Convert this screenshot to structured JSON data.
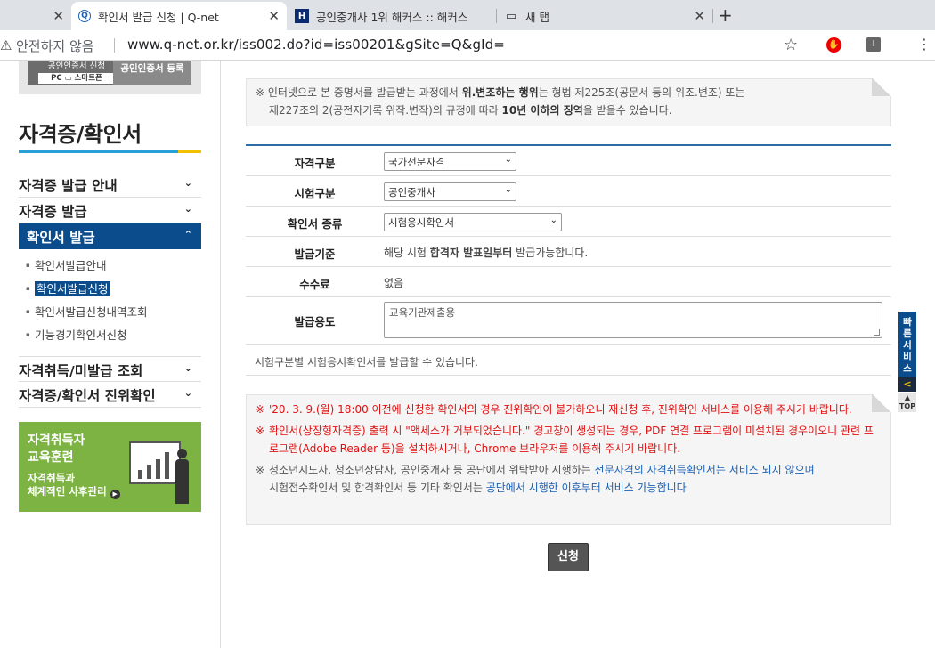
{
  "browser": {
    "tabs": [
      {
        "title": "",
        "close": "✕"
      },
      {
        "title": "확인서 발급 신청 | Q-net",
        "close": "✕",
        "fav": "Q"
      },
      {
        "title": "공인중개사 1위 해커스 :: 해커스",
        "close": "✕",
        "fav": "H"
      },
      {
        "title": "새 탭",
        "close": "✕",
        "fav": "▭"
      }
    ],
    "new_tab": "+",
    "security_text": "안전하지 않음",
    "url": "www.q-net.or.kr/iss002.do?id=iss00201&gSite=Q&gId="
  },
  "sidebar": {
    "cert_apply": "공인인증서 신청",
    "cert_pc": "PC ▭ 스마트폰",
    "cert_register": "공인인증서 등록",
    "title": "자격증/확인서",
    "menu": [
      {
        "label": "자격증 발급 안내"
      },
      {
        "label": "자격증 발급"
      },
      {
        "label": "확인서 발급"
      }
    ],
    "submenu": [
      {
        "label": "확인서발급안내"
      },
      {
        "label": "확인서발급신청"
      },
      {
        "label": "확인서발급신청내역조회"
      },
      {
        "label": "기능경기확인서신청"
      }
    ],
    "menu2": [
      {
        "label": "자격취득/미발급 조회"
      },
      {
        "label": "자격증/확인서 진위확인"
      }
    ],
    "banner": {
      "line1": "자격취득자",
      "line2": "교육훈련",
      "line3": "자격취득과",
      "line4": "체계적인 사후관리"
    }
  },
  "notice_top": {
    "part1": "※ 인터넷으로 본 증명서를 발급받는 과정에서 ",
    "bold1": "위.변조하는 행위",
    "part2": "는 형법 제225조(공문서 등의 위조.변조) 또는",
    "part3": "제227조의 2(공전자기록 위작.변작)의 규정에 따라 ",
    "bold2": "10년 이하의 징역",
    "part4": "을 받을수 있습니다."
  },
  "form": {
    "qual_type_label": "자격구분",
    "qual_type_value": "국가전문자격",
    "exam_type_label": "시험구분",
    "exam_type_value": "공인중개사",
    "cert_kind_label": "확인서 종류",
    "cert_kind_value": "시험응시확인서",
    "criteria_label": "발급기준",
    "criteria_pre": "해당 시험 ",
    "criteria_bold": "합격자 발표일부터",
    "criteria_post": " 발급가능합니다.",
    "fee_label": "수수료",
    "fee_value": "없음",
    "purpose_label": "발급용도",
    "purpose_value": "교육기관제출용",
    "info": "시험구분별 시험응시확인서를 발급할 수 있습니다."
  },
  "notice_bottom": {
    "mark": "※",
    "red1": "'20. 3. 9.(월) 18:00 이전에 신청한 확인서의 경우 진위확인이 불가하오니 재신청 후, 진위확인 서비스를 이용해 주시기 바랍니다.",
    "red2": "확인서(상장형자격증) 출력 시 \"액세스가 거부되었습니다.\" 경고창이 생성되는 경우, PDF 연결 프로그램이 미설치된 경우이오니 관련 프로그램(Adobe Reader 등)을 설치하시거나, Chrome 브라우저를 이용해 주시기 바랍니다.",
    "gray_a": "청소년지도사, 청소년상담사, 공인중개사 등 공단에서 위탁받아 시행하는 ",
    "blue_a": "전문자격의 자격취득확인서는 서비스 되지 않으며",
    "gray_b": "시험접수확인서 및 합격확인서 등 기타 확인서는 ",
    "blue_b": "공단에서 시행한 이후부터 서비스 가능합니다"
  },
  "apply_button": "신청",
  "quick": {
    "label": "빠른서비스",
    "arrow": "<",
    "top": "TOP"
  }
}
